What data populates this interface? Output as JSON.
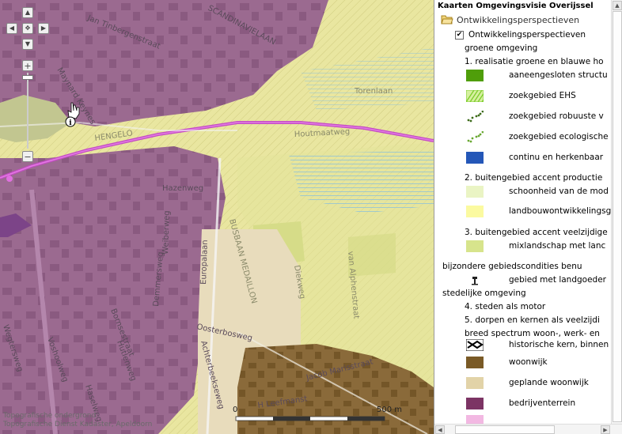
{
  "map": {
    "streets": [
      "Jan Tinbergenstraat",
      "SCANDINAVIELAAN",
      "Maynard Keynes",
      "Torenlaan",
      "HENGELO",
      "Houtmaatweg",
      "Hazenweg",
      "BUSBAAN MEDAILLON",
      "Weiberweg",
      "Europalaan",
      "Demmersweg",
      "Diekweg",
      "van Alphenstraat",
      "Oosterbosweg",
      "Bornsestraat",
      "Voshoolweg",
      "Hutlenweg",
      "Wegtersweg",
      "Haselweg",
      "Achterbeekseweg",
      "Jacob Marisstraat",
      "H Leefmanst"
    ],
    "scale": {
      "start": "0",
      "end": "500 m"
    },
    "copyright_line1": "Topografische ondergrond",
    "copyright_line2": "Topografische Dienst Kadaster, Apeldoorn",
    "controls": {
      "up": "▲",
      "down": "▼",
      "left": "◀",
      "right": "▶",
      "center": "✥",
      "zoom_in": "+",
      "zoom_out": "−"
    }
  },
  "legend": {
    "title": "Kaarten Omgevingsvisie Overijssel",
    "folder": "Ontwikkelingsperspectieven",
    "layer_label": "Ontwikkelingsperspectieven",
    "layer_checked": true,
    "items": [
      {
        "kind": "text",
        "label": "groene omgeving"
      },
      {
        "kind": "text",
        "label": "1. realisatie groene en blauwe ho"
      },
      {
        "kind": "swatch",
        "swatch": "solid-green",
        "color": "#4f9e0a",
        "label": "aaneengesloten structu"
      },
      {
        "kind": "swatch",
        "swatch": "hatch-green",
        "color": "#7ccc2a",
        "label": "zoekgebied EHS"
      },
      {
        "kind": "swatch",
        "swatch": "dots-dark",
        "color": "#3d6b1a",
        "label": "zoekgebied robuuste v"
      },
      {
        "kind": "swatch",
        "swatch": "dots-light",
        "color": "#6aa832",
        "label": "zoekgebied ecologische"
      },
      {
        "kind": "swatch",
        "swatch": "solid-blue",
        "color": "#2457b8",
        "label": "continu en herkenbaar"
      },
      {
        "kind": "text",
        "label": "2. buitengebied accent productie"
      },
      {
        "kind": "swatch",
        "swatch": "solid",
        "color": "#eaf4c4",
        "label": "schoonheid van de mod"
      },
      {
        "kind": "swatch",
        "swatch": "solid",
        "color": "#fbfaa0",
        "label": "landbouwontwikkelingsg"
      },
      {
        "kind": "text",
        "label": "3. buitengebied accent veelzijdige"
      },
      {
        "kind": "swatch",
        "swatch": "solid",
        "color": "#d7e48c",
        "label": "mixlandschap met lanc"
      },
      {
        "kind": "text-left",
        "label": "bijzondere gebiedscondities benu"
      },
      {
        "kind": "swatch",
        "swatch": "mansion",
        "color": "#222222",
        "label": "gebied met landgoeder"
      },
      {
        "kind": "text-left",
        "label": "stedelijke omgeving"
      },
      {
        "kind": "text",
        "label": "4. steden als motor"
      },
      {
        "kind": "text",
        "label": "5. dorpen en kernen als veelzijdi"
      },
      {
        "kind": "text",
        "label": "breed spectrum woon-, werk- en"
      },
      {
        "kind": "swatch",
        "swatch": "historic",
        "color": "#3a2a1a",
        "label": "historische kern, binnen"
      },
      {
        "kind": "swatch",
        "swatch": "solid",
        "color": "#7a5a26",
        "label": "woonwijk"
      },
      {
        "kind": "swatch",
        "swatch": "solid",
        "color": "#e2d3a8",
        "label": "geplande woonwijk"
      },
      {
        "kind": "swatch",
        "swatch": "solid",
        "color": "#7c3464",
        "label": "bedrijventerrein"
      },
      {
        "kind": "swatch",
        "swatch": "solid",
        "color": "#f2b8e2",
        "label": ""
      }
    ]
  },
  "colors": {
    "bedrijventerrein": "#9b6a90",
    "landbouw": "#e6e59a",
    "woonwijk": "#8a6a3a",
    "gepland": "#e8dcbc",
    "road": "#c44bc4",
    "mixland": "#d4dc86"
  }
}
